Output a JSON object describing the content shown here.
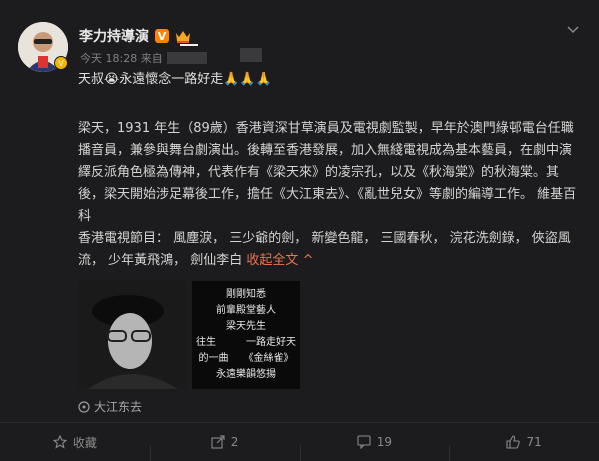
{
  "post": {
    "author": "李力持導演",
    "meta_time": "今天 18:28 来自",
    "short_text": "天叔😭永遠懷念一路好走🙏🙏🙏",
    "body": {
      "para1_a": "梁天，1931 年生（89歲）香港資深甘草演員及電視劇監製，早年於澳門綠邨電台任職播音員，兼參與舞台劇演出。後轉至香港發展，加入無綫電視成為基本藝員，在劇中演繹反派角色極為傳神，代表作有《梁天來》的凌宗孔，以及《秋海棠》的秋海棠。其後，梁天開始涉足幕後工作，擔任《大江東去》、《亂世兒女》等劇的編導工作。",
      "para1_b": "維基百科",
      "para2": "香港電視節目： 風塵淚， 三少爺的劍， 新變色龍， 三國春秋， 浣花洗劍錄， 俠盜風流， 少年黃飛鴻， 劍仙李白",
      "collapse": "收起全文"
    },
    "image2_lines": [
      "剛剛知悉",
      "前輩殿堂藝人",
      "梁天先生",
      "往生　　　一路走好天",
      "的一曲　　《金絲雀》",
      "永遠樂韻悠揚"
    ],
    "location": "大江东去"
  },
  "actions": [
    {
      "name": "favorite",
      "label": "收藏"
    },
    {
      "name": "repost",
      "label": "2"
    },
    {
      "name": "comment",
      "label": "19"
    },
    {
      "name": "like",
      "label": "71"
    }
  ]
}
